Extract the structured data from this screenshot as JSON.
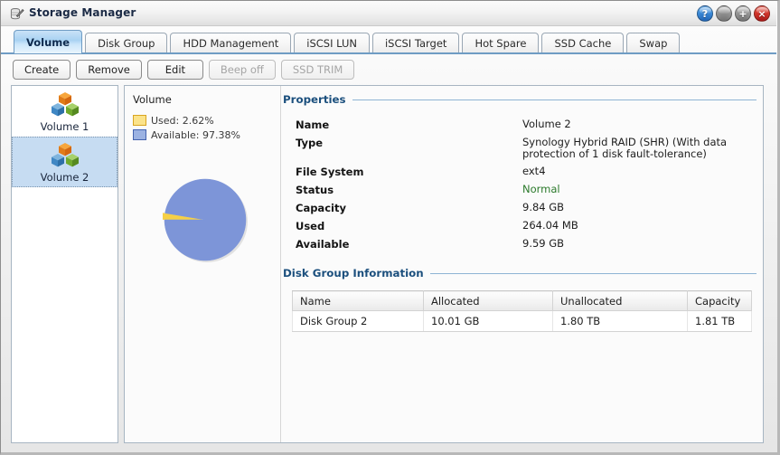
{
  "window": {
    "title": "Storage Manager",
    "icon": "storage-disk-icon",
    "buttons": [
      {
        "name": "help-button",
        "glyph": "?",
        "kind": "help"
      },
      {
        "name": "minimize-button",
        "glyph": "",
        "kind": "min"
      },
      {
        "name": "maximize-button",
        "glyph": "+",
        "kind": "max"
      },
      {
        "name": "close-button",
        "glyph": "×",
        "kind": "close"
      }
    ]
  },
  "tabs": [
    {
      "label": "Volume",
      "active": true
    },
    {
      "label": "Disk Group",
      "active": false
    },
    {
      "label": "HDD Management",
      "active": false
    },
    {
      "label": "iSCSI LUN",
      "active": false
    },
    {
      "label": "iSCSI Target",
      "active": false
    },
    {
      "label": "Hot Spare",
      "active": false
    },
    {
      "label": "SSD Cache",
      "active": false
    },
    {
      "label": "Swap",
      "active": false
    }
  ],
  "toolbar": [
    {
      "label": "Create",
      "disabled": false
    },
    {
      "label": "Remove",
      "disabled": false
    },
    {
      "label": "Edit",
      "disabled": false
    },
    {
      "label": "Beep off",
      "disabled": true
    },
    {
      "label": "SSD TRIM",
      "disabled": true
    }
  ],
  "sidebar": {
    "items": [
      {
        "label": "Volume 1",
        "selected": false
      },
      {
        "label": "Volume 2",
        "selected": true
      }
    ]
  },
  "volume_panel": {
    "title": "Volume",
    "legend": [
      {
        "label": "Used: 2.62%",
        "color": "#fbe38a",
        "border": "#d9a521"
      },
      {
        "label": "Available: 97.38%",
        "color": "#9bb2e2",
        "border": "#4463ae"
      }
    ]
  },
  "chart_data": {
    "type": "pie",
    "title": "Volume",
    "labels": [
      "Used",
      "Available"
    ],
    "values": [
      2.62,
      97.38
    ],
    "unit": "%",
    "colors": [
      "#f6d046",
      "#7d95d8"
    ],
    "legend_position": "top-left",
    "exploded_slice": "Used",
    "start_angle_deg": 180
  },
  "properties": {
    "section_title": "Properties",
    "rows": [
      {
        "key": "Name",
        "value": "Volume 2"
      },
      {
        "key": "Type",
        "value": "Synology Hybrid RAID (SHR) (With data protection of 1 disk fault-tolerance)"
      },
      {
        "key": "File System",
        "value": "ext4"
      },
      {
        "key": "Status",
        "value": "Normal",
        "style": "green"
      },
      {
        "key": "Capacity",
        "value": "9.84 GB"
      },
      {
        "key": "Used",
        "value": "264.04 MB"
      },
      {
        "key": "Available",
        "value": "9.59 GB"
      }
    ]
  },
  "disk_group": {
    "section_title": "Disk Group Information",
    "columns": [
      "Name",
      "Allocated",
      "Unallocated",
      "Capacity"
    ],
    "rows": [
      {
        "name": "Disk Group 2",
        "allocated": "10.01 GB",
        "unallocated": "1.80 TB",
        "capacity": "1.81 TB"
      }
    ]
  }
}
